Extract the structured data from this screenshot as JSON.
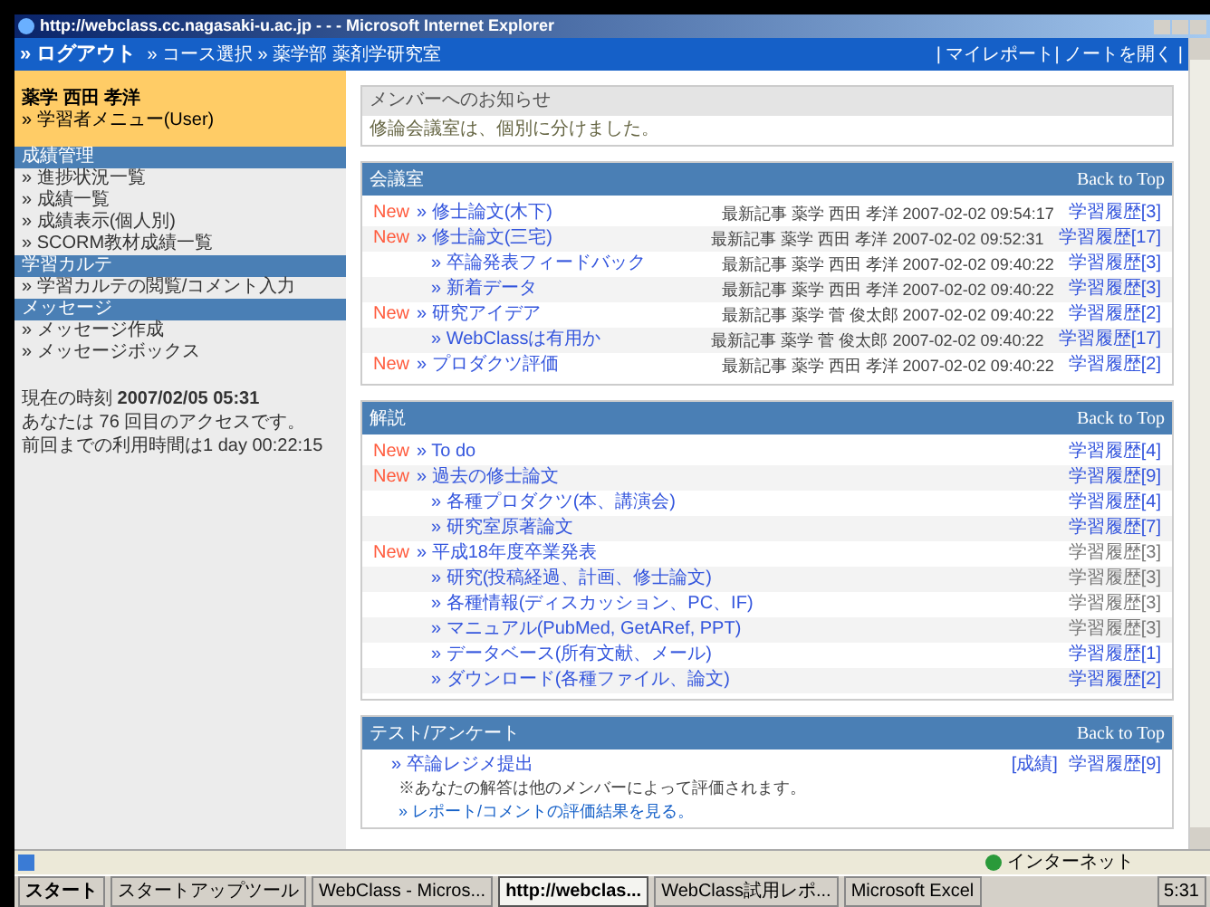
{
  "window": {
    "title": "http://webclass.cc.nagasaki-u.ac.jp - - - Microsoft Internet Explorer"
  },
  "nav": {
    "logout": "» ログアウト",
    "breadcrumb": "» コース選択 » 薬学部 薬剤学研究室",
    "right_links": [
      "| マイレポート",
      "| ノートを開く |"
    ]
  },
  "sidebar": {
    "user": "薬学 西田 孝洋",
    "user_menu": "» 学習者メニュー(User)",
    "sections": [
      {
        "title": "成績管理",
        "items": [
          "» 進捗状況一覧",
          "» 成績一覧",
          "» 成績表示(個人別)",
          "» SCORM教材成績一覧"
        ]
      },
      {
        "title": "学習カルテ",
        "items": [
          "» 学習カルテの閲覧/コメント入力"
        ]
      },
      {
        "title": "メッセージ",
        "items": [
          "» メッセージ作成",
          "» メッセージボックス"
        ]
      }
    ],
    "info": [
      "現在の時刻 **2007/02/05 05:31**",
      "あなたは 76 回目のアクセスです。",
      "前回までの利用時間は1 day 00:22:15"
    ]
  },
  "notice": {
    "title": "メンバーへのお知らせ",
    "body": "修論会議室は、個別に分けました。"
  },
  "panels": [
    {
      "title": "会議室",
      "back": "Back to Top",
      "rows": [
        {
          "badge": "New",
          "label": "» 修士論文(木下)",
          "meta": "最新記事 薬学 西田 孝洋 2007-02-02 09:54:17",
          "link": "学習履歴[3]",
          "muted": false,
          "children": []
        },
        {
          "badge": "New",
          "label": "» 修士論文(三宅)",
          "meta": "最新記事 薬学 西田 孝洋 2007-02-02 09:52:31",
          "link": "学習履歴[17]",
          "muted": false,
          "children": [
            {
              "label": "» 卒論発表フィードバック",
              "meta": "最新記事 薬学 西田 孝洋 2007-02-02 09:40:22",
              "link": "学習履歴[3]",
              "muted": false
            },
            {
              "label": "» 新着データ",
              "meta": "最新記事 薬学 西田 孝洋 2007-02-02 09:40:22",
              "link": "学習履歴[3]",
              "muted": false
            }
          ]
        },
        {
          "badge": "New",
          "label": "» 研究アイデア",
          "meta": "最新記事 薬学 菅 俊太郎 2007-02-02 09:40:22",
          "link": "学習履歴[2]",
          "muted": false,
          "children": [
            {
              "label": "» WebClassは有用か",
              "meta": "最新記事 薬学 菅 俊太郎 2007-02-02 09:40:22",
              "link": "学習履歴[17]",
              "muted": false
            }
          ]
        },
        {
          "badge": "New",
          "label": "» プロダクツ評価",
          "meta": "最新記事 薬学 西田 孝洋 2007-02-02 09:40:22",
          "link": "学習履歴[2]",
          "muted": false,
          "children": []
        }
      ]
    },
    {
      "title": "解説",
      "back": "Back to Top",
      "rows": [
        {
          "badge": "New",
          "label": "» To do",
          "link": "学習履歴[4]",
          "muted": false,
          "children": []
        },
        {
          "badge": "New",
          "label": "» 過去の修士論文",
          "link": "学習履歴[9]",
          "muted": false,
          "children": [
            {
              "label": "» 各種プロダクツ(本、講演会)",
              "link": "学習履歴[4]",
              "muted": false
            },
            {
              "label": "» 研究室原著論文",
              "link": "学習履歴[7]",
              "muted": false
            }
          ]
        },
        {
          "badge": "New",
          "label": "» 平成18年度卒業発表",
          "link": "学習履歴[3]",
          "muted": true,
          "children": [
            {
              "label": "» 研究(投稿経過、計画、修士論文)",
              "link": "学習履歴[3]",
              "muted": true
            },
            {
              "label": "» 各種情報(ディスカッション、PC、IF)",
              "link": "学習履歴[3]",
              "muted": true
            },
            {
              "label": "» マニュアル(PubMed, GetARef, PPT)",
              "link": "学習履歴[3]",
              "muted": true
            },
            {
              "label": "» データベース(所有文献、メール)",
              "link": "学習履歴[1]",
              "muted": false
            },
            {
              "label": "» ダウンロード(各種ファイル、論文)",
              "link": "学習履歴[2]",
              "muted": false
            }
          ]
        }
      ]
    }
  ],
  "test": {
    "title": "テスト/アンケート",
    "back": "Back to Top",
    "item": "» 卒論レジメ提出",
    "result": "[成績]",
    "link": "学習履歴[9]",
    "note": "※あなたの解答は他のメンバーによって評価されます。",
    "note_link": "» レポート/コメントの評価結果を見る。"
  },
  "status_bar": {
    "zone": "インターネット"
  },
  "taskbar": {
    "start": "スタート",
    "items": [
      {
        "label": "スタートアップツール",
        "selected": false
      },
      {
        "label": "WebClass - Micros...",
        "selected": false
      },
      {
        "label": "http://webclas...",
        "selected": true
      },
      {
        "label": "WebClass試用レポ...",
        "selected": false
      },
      {
        "label": "Microsoft Excel",
        "selected": false
      }
    ],
    "clock": "5:31"
  }
}
